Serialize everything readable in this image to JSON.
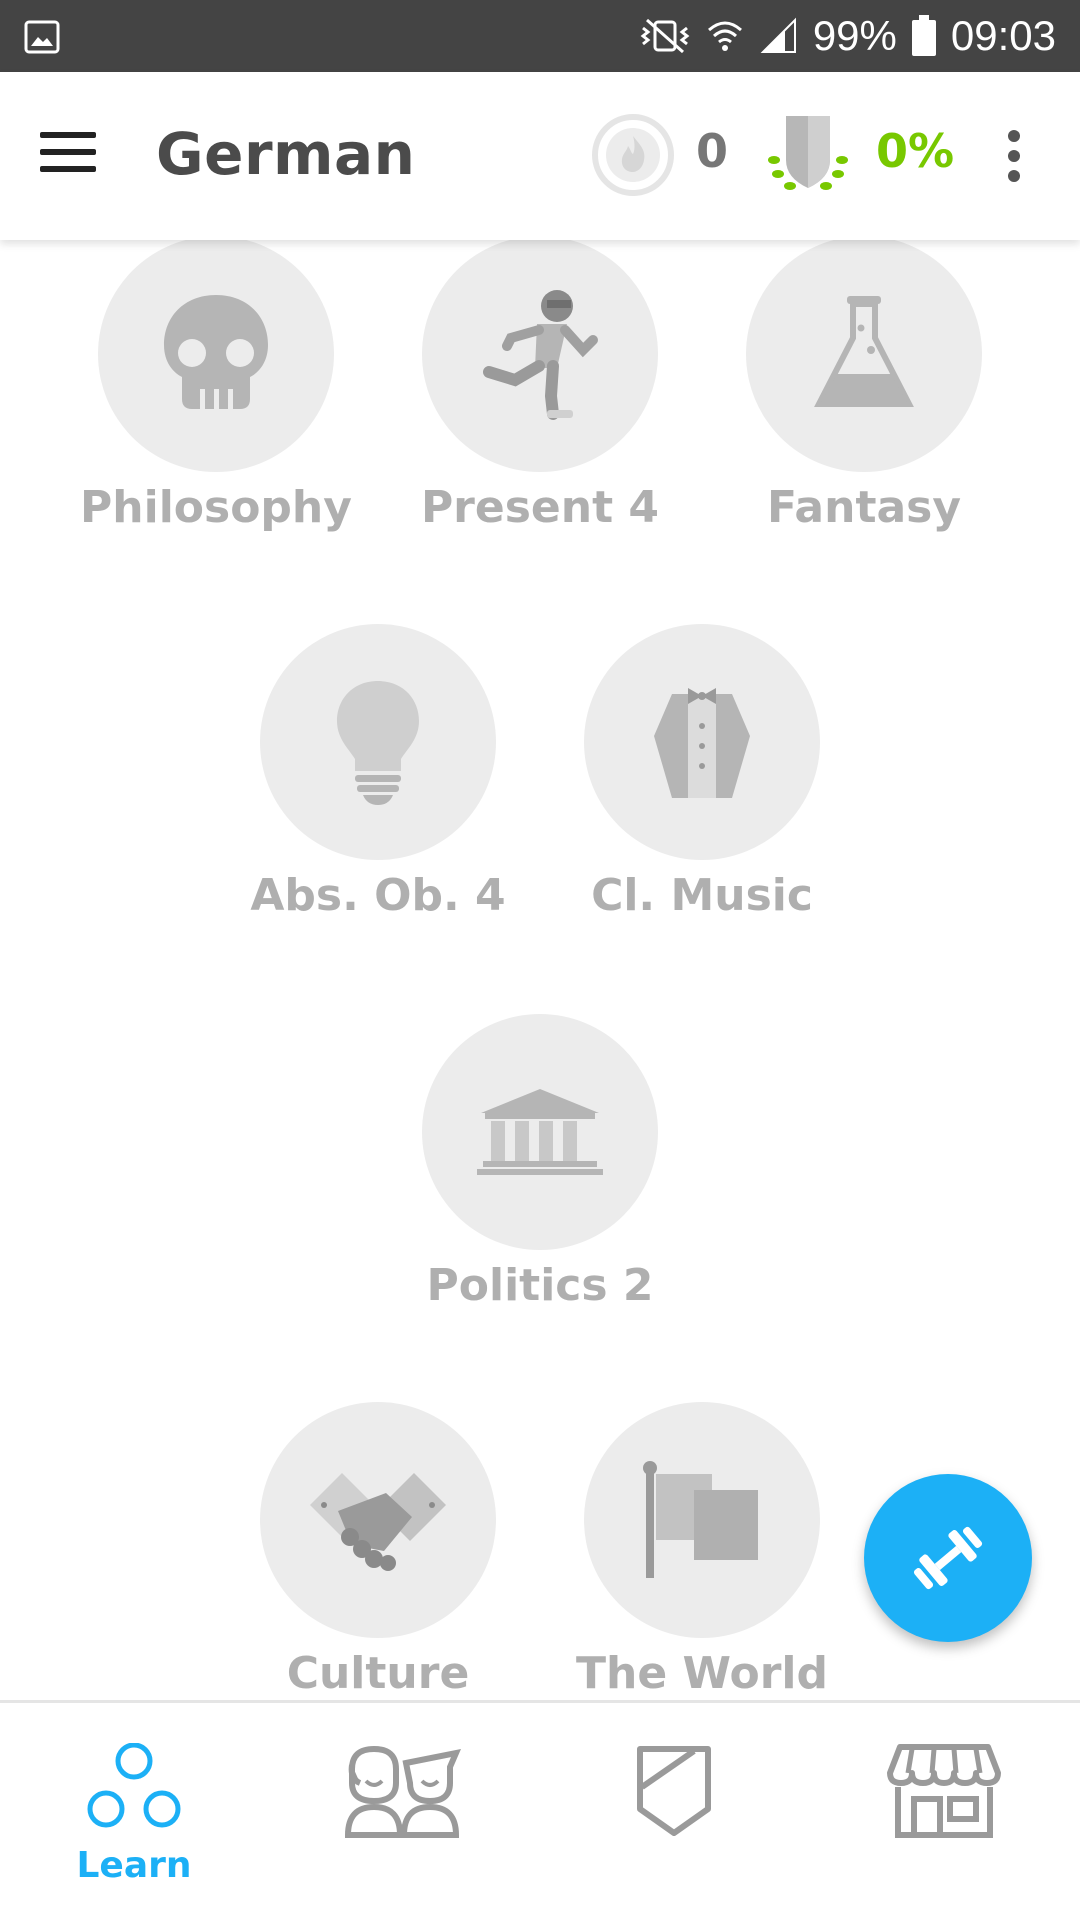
{
  "status_bar": {
    "battery": "99%",
    "time": "09:03"
  },
  "app_bar": {
    "title": "German",
    "streak_count": "0",
    "crown_percent": "0%"
  },
  "skills": [
    {
      "label": "Philosophy",
      "icon": "skull-icon"
    },
    {
      "label": "Present 4",
      "icon": "running-person-icon"
    },
    {
      "label": "Fantasy",
      "icon": "potion-flask-icon"
    },
    {
      "label": "Abs. Ob. 4",
      "icon": "lightbulb-icon"
    },
    {
      "label": "Cl. Music",
      "icon": "tuxedo-icon"
    },
    {
      "label": "Politics 2",
      "icon": "government-building-icon"
    },
    {
      "label": "Culture",
      "icon": "handshake-icon"
    },
    {
      "label": "The World",
      "icon": "flag-icon"
    }
  ],
  "bottom_nav": {
    "learn_label": "Learn"
  },
  "colors": {
    "accent_blue": "#1cb0f6",
    "crown_green": "#78c800",
    "skill_circle": "#ececec",
    "skill_label": "#afafaf"
  }
}
